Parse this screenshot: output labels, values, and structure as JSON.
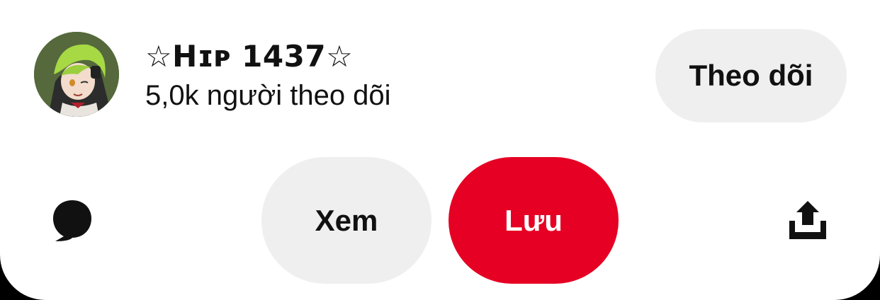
{
  "creator": {
    "name": "☆Hɪᴘ 1437☆",
    "followers": "5,0k người theo dõi",
    "follow_label": "Theo dõi"
  },
  "actions": {
    "view_label": "Xem",
    "save_label": "Lưu"
  },
  "icons": {
    "comment": "comment-icon",
    "share": "share-icon"
  },
  "colors": {
    "save_button": "#e60023",
    "secondary_button": "#efefef",
    "text": "#111111"
  }
}
